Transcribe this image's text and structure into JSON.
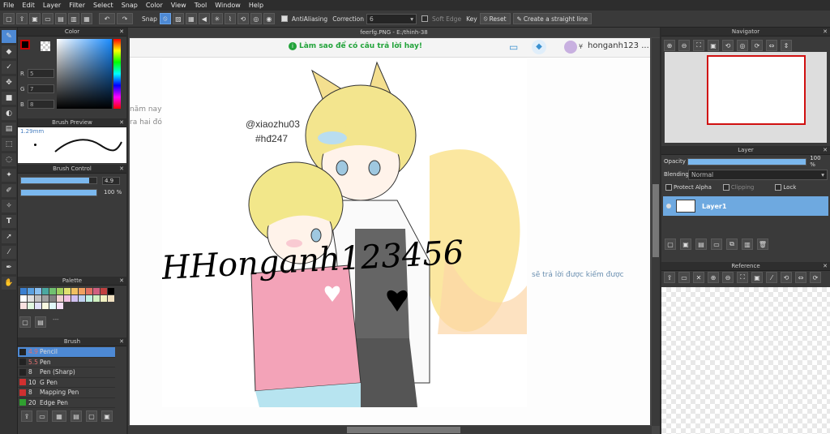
{
  "menu": [
    "File",
    "Edit",
    "Layer",
    "Filter",
    "Select",
    "Snap",
    "Color",
    "View",
    "Tool",
    "Window",
    "Help"
  ],
  "toolbar": {
    "snap_label": "Snap",
    "antialiasing_label": "AntiAliasing",
    "correction_label": "Correction",
    "correction_value": "6",
    "soft_edge_label": "Soft Edge",
    "key_label": "Key",
    "reset_label": "Reset",
    "straight_line_label": "Create a straight line"
  },
  "color_panel": {
    "title": "Color",
    "r_label": "R",
    "r_value": "5",
    "g_label": "G",
    "g_value": "7",
    "b_label": "B",
    "b_value": "8"
  },
  "brush_preview": {
    "title": "Brush Preview",
    "size": "1.29mm"
  },
  "brush_control": {
    "title": "Brush Control",
    "size_value": "4.9",
    "opacity_value": "100 %",
    "size_fraction": 0.9,
    "opacity_fraction": 1.0
  },
  "palette": {
    "title": "Palette",
    "colors": [
      "#3a7fd0",
      "#5aa0e0",
      "#8ac0f0",
      "#4aa8a0",
      "#70c070",
      "#a0d060",
      "#e0e070",
      "#f0c060",
      "#f0a060",
      "#e07060",
      "#d06080",
      "#c04040",
      "#000000",
      "#ffffff",
      "#e0e0e0",
      "#c0c0c0",
      "#a0a0a0",
      "#808080",
      "#f0d0d0",
      "#f0c0e0",
      "#d0c0f0",
      "#c0d0f0",
      "#c0f0e0",
      "#d0f0c0",
      "#f0f0c0",
      "#f0e0c0",
      "#f8e0e0",
      "#e0f8e0",
      "#e0e0f8",
      "#f8f8e0",
      "#e0f8f8",
      "#f8e0f8"
    ]
  },
  "brush_panel": {
    "title": "Brush",
    "items": [
      {
        "size": "4.9",
        "name": "Pencil",
        "color": "#222222",
        "selected": true
      },
      {
        "size": "5.5",
        "name": "Pen",
        "color": "#222222",
        "selected": false
      },
      {
        "size": "8",
        "name": "Pen (Sharp)",
        "color": "#222222",
        "selected": false
      },
      {
        "size": "10",
        "name": "G Pen",
        "color": "#d03030",
        "selected": false
      },
      {
        "size": "8",
        "name": "Mapping Pen",
        "color": "#d03030",
        "selected": false
      },
      {
        "size": "20",
        "name": "Edge Pen",
        "color": "#30a030",
        "selected": false
      }
    ]
  },
  "document": {
    "title": "feerfg.PNG - E:/thinh-38"
  },
  "page": {
    "hint": "Làm sao để có câu trả lời hay!",
    "username": "honganh123 ...",
    "watermark_1": "@xiaozhu03",
    "watermark_2": "#hđ247",
    "signature": "HHonganh123456",
    "bg_text_1": "năm nay",
    "bg_text_2": "ra hai đó",
    "bg_text_3": "sẽ trả lời được kiếm được"
  },
  "navigator": {
    "title": "Navigator"
  },
  "layer_panel": {
    "title": "Layer",
    "opacity_label": "Opacity",
    "opacity_value": "100 %",
    "blending_label": "Blending",
    "blending_value": "Normal",
    "protect_alpha_label": "Protect Alpha",
    "clipping_label": "Clipping",
    "lock_label": "Lock",
    "layer_name": "Layer1"
  },
  "reference": {
    "title": "Reference"
  }
}
